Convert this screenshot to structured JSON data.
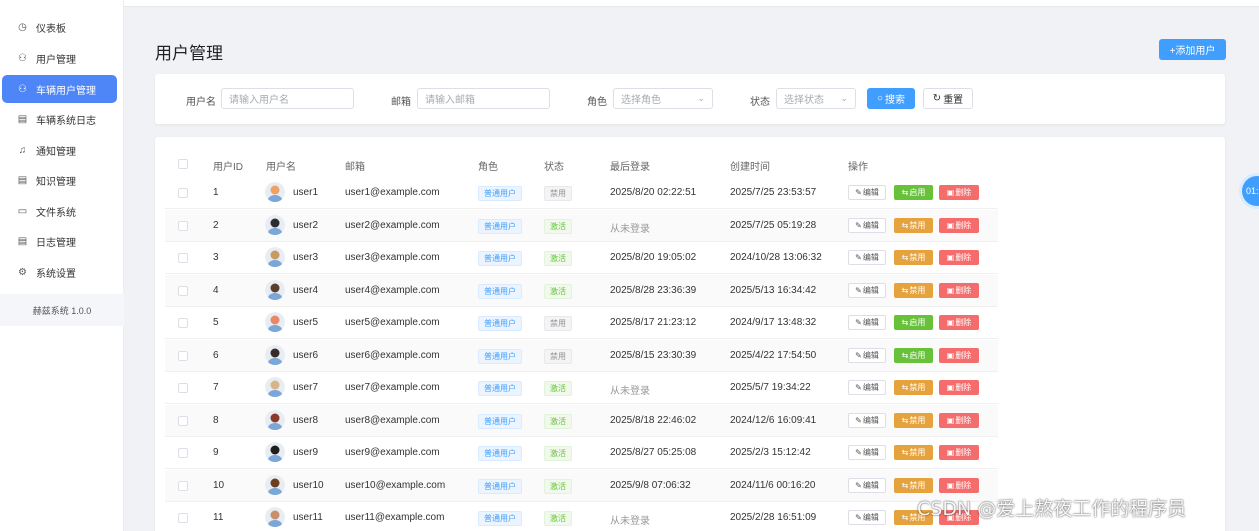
{
  "sidebar": {
    "items": [
      {
        "label": "仪表板",
        "icon": "dashboard-icon",
        "active": false
      },
      {
        "label": "用户管理",
        "icon": "user-icon",
        "active": false
      },
      {
        "label": "车辆用户管理",
        "icon": "user-icon",
        "active": true
      },
      {
        "label": "车辆系统日志",
        "icon": "document-icon",
        "active": false
      },
      {
        "label": "通知管理",
        "icon": "bell-icon",
        "active": false
      },
      {
        "label": "知识管理",
        "icon": "document-icon",
        "active": false
      },
      {
        "label": "文件系统",
        "icon": "folder-icon",
        "active": false
      },
      {
        "label": "日志管理",
        "icon": "document-icon",
        "active": false
      },
      {
        "label": "系统设置",
        "icon": "gear-icon",
        "active": false
      }
    ],
    "version": "赫兹系统 1.0.0"
  },
  "header": {
    "title": "用户管理",
    "add_button": "+添加用户"
  },
  "filters": {
    "username_label": "用户名",
    "username_placeholder": "请输入用户名",
    "email_label": "邮箱",
    "email_placeholder": "请输入邮箱",
    "role_label": "角色",
    "role_placeholder": "选择角色",
    "status_label": "状态",
    "status_placeholder": "选择状态",
    "search_button": "搜索",
    "reset_button": "重置"
  },
  "table": {
    "columns": [
      "用户ID",
      "用户名",
      "邮箱",
      "角色",
      "状态",
      "最后登录",
      "创建时间",
      "操作"
    ],
    "edit_label": "编辑",
    "enable_label": "启用",
    "disable_label": "禁用",
    "delete_label": "删除",
    "rows": [
      {
        "id": "1",
        "username": "user1",
        "email": "user1@example.com",
        "role": "普通用户",
        "status": "禁用",
        "last_login": "2025/8/20 02:22:51",
        "created": "2025/7/25 23:53:57",
        "toggle": "启用",
        "avatar_color": "#f0a060"
      },
      {
        "id": "2",
        "username": "user2",
        "email": "user2@example.com",
        "role": "普通用户",
        "status": "激活",
        "last_login": "从未登录",
        "created": "2025/7/25 05:19:28",
        "toggle": "禁用",
        "avatar_color": "#2d2d2d"
      },
      {
        "id": "3",
        "username": "user3",
        "email": "user3@example.com",
        "role": "普通用户",
        "status": "激活",
        "last_login": "2025/8/20 19:05:02",
        "created": "2024/10/28 13:06:32",
        "toggle": "禁用",
        "avatar_color": "#c89a64"
      },
      {
        "id": "4",
        "username": "user4",
        "email": "user4@example.com",
        "role": "普通用户",
        "status": "激活",
        "last_login": "2025/8/28 23:36:39",
        "created": "2025/5/13 16:34:42",
        "toggle": "禁用",
        "avatar_color": "#5a3d2b"
      },
      {
        "id": "5",
        "username": "user5",
        "email": "user5@example.com",
        "role": "普通用户",
        "status": "禁用",
        "last_login": "2025/8/17 21:23:12",
        "created": "2024/9/17 13:48:32",
        "toggle": "启用",
        "avatar_color": "#e8886a"
      },
      {
        "id": "6",
        "username": "user6",
        "email": "user6@example.com",
        "role": "普通用户",
        "status": "禁用",
        "last_login": "2025/8/15 23:30:39",
        "created": "2025/4/22 17:54:50",
        "toggle": "启用",
        "avatar_color": "#3a2a2a"
      },
      {
        "id": "7",
        "username": "user7",
        "email": "user7@example.com",
        "role": "普通用户",
        "status": "激活",
        "last_login": "从未登录",
        "created": "2025/5/7 19:34:22",
        "toggle": "禁用",
        "avatar_color": "#d8b48a"
      },
      {
        "id": "8",
        "username": "user8",
        "email": "user8@example.com",
        "role": "普通用户",
        "status": "激活",
        "last_login": "2025/8/18 22:46:02",
        "created": "2024/12/6 16:09:41",
        "toggle": "禁用",
        "avatar_color": "#8a3a2a"
      },
      {
        "id": "9",
        "username": "user9",
        "email": "user9@example.com",
        "role": "普通用户",
        "status": "激活",
        "last_login": "2025/8/27 05:25:08",
        "created": "2025/2/3 15:12:42",
        "toggle": "禁用",
        "avatar_color": "#1e1e1e"
      },
      {
        "id": "10",
        "username": "user10",
        "email": "user10@example.com",
        "role": "普通用户",
        "status": "激活",
        "last_login": "2025/9/8 07:06:32",
        "created": "2024/11/6 00:16:20",
        "toggle": "禁用",
        "avatar_color": "#6a4020"
      },
      {
        "id": "11",
        "username": "user11",
        "email": "user11@example.com",
        "role": "普通用户",
        "status": "激活",
        "last_login": "从未登录",
        "created": "2025/2/28 16:51:09",
        "toggle": "禁用",
        "avatar_color": "#c8906a"
      }
    ]
  },
  "float_button": "01:",
  "watermark": "CSDN @爱上熬夜工作的程序员",
  "colors": {
    "primary": "#409eff",
    "sidebar_active": "#4f86f7",
    "success": "#67c23a",
    "warning": "#e6a23c",
    "danger": "#f56c6c"
  }
}
